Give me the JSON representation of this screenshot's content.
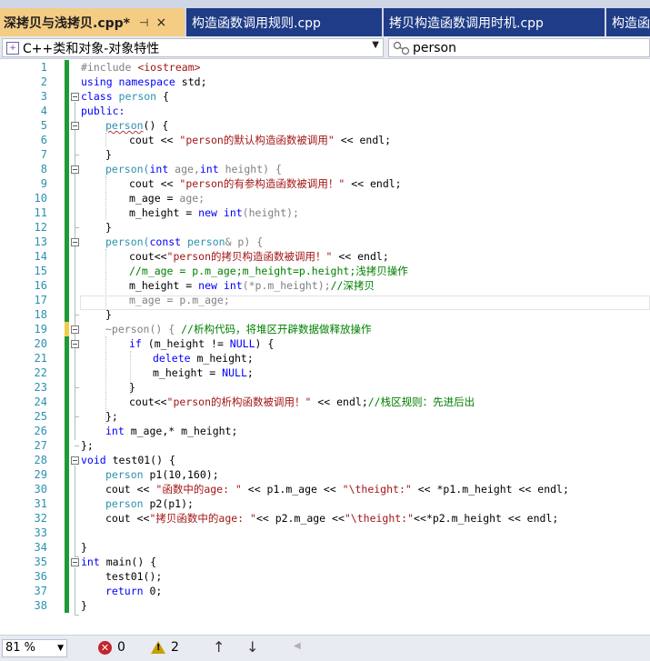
{
  "tabs": [
    {
      "label": "深拷贝与浅拷贝.cpp*",
      "active": true,
      "pin": "⊣",
      "close": "×"
    },
    {
      "label": "构造函数调用规则.cpp"
    },
    {
      "label": "拷贝构造函数调用时机.cpp"
    },
    {
      "label": "构造函数"
    }
  ],
  "navbar": {
    "scope": "C++类和对象-对象特性",
    "member": "person"
  },
  "editor": {
    "line_numbers": [
      "1",
      "2",
      "3",
      "4",
      "5",
      "6",
      "7",
      "8",
      "9",
      "10",
      "11",
      "12",
      "13",
      "14",
      "15",
      "16",
      "17",
      "18",
      "19",
      "20",
      "21",
      "22",
      "23",
      "24",
      "25",
      "26",
      "27",
      "28",
      "29",
      "30",
      "31",
      "32",
      "33",
      "34",
      "35",
      "36",
      "37",
      "38"
    ],
    "code": {
      "l1a": "#include ",
      "l1b": "<iostream>",
      "l2a": "using",
      "l2b": " namespace ",
      "l2c": "std;",
      "l3a": "class ",
      "l3b": "person",
      "l3c": " {",
      "l4": "public:",
      "l5a": "person",
      "l5b": "() {",
      "l6a": "cout << ",
      "l6b": "\"person的默认构造函数被调用\"",
      "l6c": " << endl;",
      "l7": "}",
      "l8a": "person(",
      "l8b": "int",
      "l8c": " age,",
      "l8d": "int",
      "l8e": " height) {",
      "l9a": "cout << ",
      "l9b": "\"person的有参构造函数被调用！\"",
      "l9c": " << endl;",
      "l10a": "m_age = ",
      "l10b": "age;",
      "l11a": "m_height = ",
      "l11b": "new",
      "l11c": " ",
      "l11d": "int",
      "l11e": "(height);",
      "l12": "}",
      "l13a": "person(",
      "l13b": "const",
      "l13c": " ",
      "l13d": "person",
      "l13e": "& p) {",
      "l14a": "cout<<",
      "l14b": "\"person的拷贝构造函数被调用！\"",
      "l14c": " << endl;",
      "l15": "//m_age = p.m_age;m_height=p.height;浅拷贝操作",
      "l16a": "m_height = ",
      "l16b": "new",
      "l16c": " ",
      "l16d": "int",
      "l16e": "(*p.m_height);",
      "l16f": "//深拷贝",
      "l17": "m_age = p.m_age;",
      "l18": "}",
      "l19a": "~person() { ",
      "l19b": "//析构代码，将堆区开辟数据做释放操作",
      "l20a": "if",
      "l20b": " (m_height != ",
      "l20c": "NULL",
      "l20d": ") {",
      "l21a": "delete",
      "l21b": " m_height;",
      "l22a": "m_height = ",
      "l22b": "NULL",
      "l22c": ";",
      "l23": "}",
      "l24a": "cout<<",
      "l24b": "\"person的析构函数被调用！\"",
      "l24c": " << endl;",
      "l24d": "//栈区规则：先进后出",
      "l25": "};",
      "l26a": "int",
      "l26b": " m_age,* m_height;",
      "l27": "};",
      "l28a": "void",
      "l28b": " test01() {",
      "l29a": "person",
      "l29b": " p1(10,160);",
      "l30a": "cout << ",
      "l30b": "\"函数中的age: \"",
      "l30c": " << p1.m_age << ",
      "l30d": "\"\\theight:\"",
      "l30e": " << *p1.m_height << endl;",
      "l31a": "person",
      "l31b": " p2(p1);",
      "l32a": "cout <<",
      "l32b": "\"拷贝函数中的age: \"",
      "l32c": "<< p2.m_age <<",
      "l32d": "\"\\theight:\"",
      "l32e": "<<*p2.m_height << endl;",
      "l34": "}",
      "l35a": "int",
      "l35b": " main() {",
      "l36": "test01();",
      "l37a": "return",
      "l37b": " 0;",
      "l38": "}"
    }
  },
  "statusbar": {
    "zoom": "81 %",
    "errors": "0",
    "warnings": "2",
    "up": "↑",
    "down": "↓",
    "back": "◀"
  }
}
